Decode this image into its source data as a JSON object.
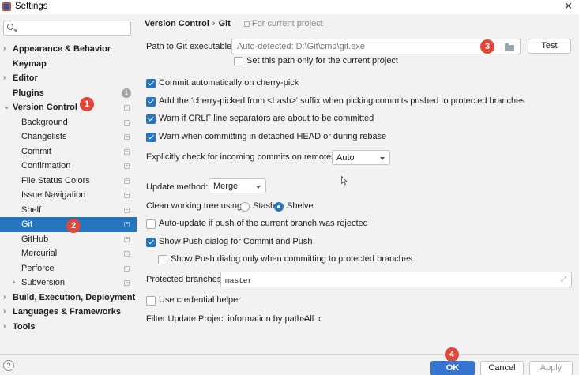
{
  "window": {
    "title": "Settings",
    "close_glyph": "✕"
  },
  "search": {
    "value": "",
    "placeholder": ""
  },
  "sidebar": {
    "items": [
      {
        "label": "Appearance & Behavior",
        "arrow": "›",
        "bold": true
      },
      {
        "label": "Keymap",
        "bold": true
      },
      {
        "label": "Editor",
        "arrow": "›",
        "bold": true
      },
      {
        "label": "Plugins",
        "bold": true,
        "count": "1"
      },
      {
        "label": "Version Control",
        "arrow": "⌄",
        "bold": true
      },
      {
        "label": "Background"
      },
      {
        "label": "Changelists"
      },
      {
        "label": "Commit"
      },
      {
        "label": "Confirmation"
      },
      {
        "label": "File Status Colors"
      },
      {
        "label": "Issue Navigation"
      },
      {
        "label": "Shelf"
      },
      {
        "label": "Git",
        "selected": true
      },
      {
        "label": "GitHub"
      },
      {
        "label": "Mercurial"
      },
      {
        "label": "Perforce"
      },
      {
        "label": "Subversion",
        "arrow": "›"
      },
      {
        "label": "Build, Execution, Deployment",
        "arrow": "›",
        "bold": true
      },
      {
        "label": "Languages & Frameworks",
        "arrow": "›",
        "bold": true
      },
      {
        "label": "Tools",
        "arrow": "›",
        "bold": true
      }
    ]
  },
  "breadcrumb": {
    "parent": "Version Control",
    "sep": "›",
    "current": "Git",
    "scope": "For current project"
  },
  "git_path": {
    "label": "Path to Git executable:",
    "placeholder": "Auto-detected: D:\\Git\\cmd\\git.exe",
    "test_button": "Test",
    "project_only_label": "Set this path only for the current project"
  },
  "options": {
    "cherry_pick_commit": "Commit automatically on cherry-pick",
    "cherry_pick_suffix": "Add the 'cherry-picked from <hash>' suffix when picking commits pushed to protected branches",
    "crlf_warn": "Warn if CRLF line separators are about to be committed",
    "detached_head_warn": "Warn when committing in detached HEAD or during rebase"
  },
  "incoming": {
    "label": "Explicitly check for incoming commits on remotes:",
    "value": "Auto"
  },
  "update_method": {
    "label": "Update method:",
    "value": "Merge"
  },
  "clean_tree": {
    "label": "Clean working tree using:",
    "stash": "Stash",
    "shelve": "Shelve"
  },
  "push": {
    "auto_update": "Auto-update if push of the current branch was rejected",
    "show_dialog": "Show Push dialog for Commit and Push",
    "protected_only": "Show Push dialog only when committing to protected branches"
  },
  "protected_branches": {
    "label": "Protected branches:",
    "value": "master"
  },
  "credential_helper": "Use credential helper",
  "filter_update": {
    "label": "Filter Update Project information by paths:",
    "value": "All"
  },
  "footer": {
    "help": "?",
    "ok": "OK",
    "cancel": "Cancel",
    "apply": "Apply"
  },
  "annotations": [
    "1",
    "2",
    "3",
    "4"
  ],
  "colors": {
    "accent": "#2675bf",
    "ok_button": "#3574d0",
    "annotation": "#e2473b"
  }
}
